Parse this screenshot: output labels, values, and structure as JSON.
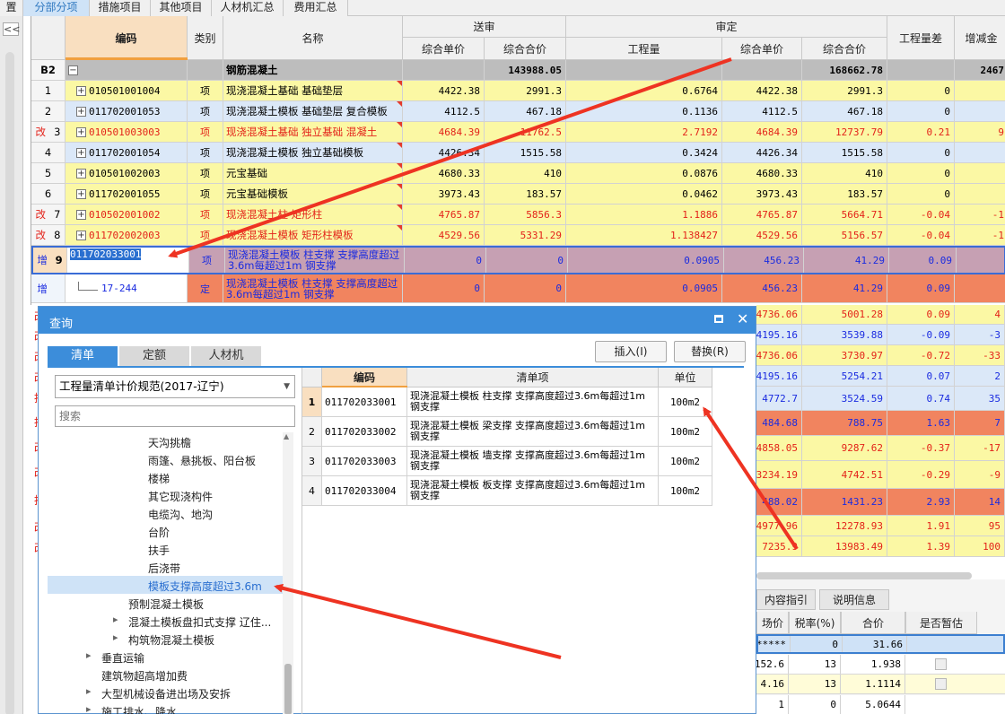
{
  "tabs": [
    "置",
    "分部分项",
    "措施项目",
    "其他项目",
    "人材机汇总",
    "费用汇总"
  ],
  "rail": {
    "collapse_label": "<<"
  },
  "grid": {
    "headers": {
      "code": "编码",
      "type": "类别",
      "name": "名称",
      "sent": "送审",
      "approved": "审定",
      "s_unit": "综合单价",
      "s_total": "综合合价",
      "qty": "工程量",
      "a_unit": "综合单价",
      "a_total": "综合合价",
      "qty_diff": "工程量差",
      "amount": "增减金"
    },
    "rows": [
      {
        "idx": "B2",
        "flag": "",
        "expander": "−",
        "code": "",
        "type": "",
        "name": "钢筋混凝土",
        "s_unit": "",
        "s_total": "143988.05",
        "qty": "",
        "a_unit": "",
        "a_total": "168662.78",
        "diff": "",
        "amt": "2467"
      },
      {
        "idx": "1",
        "flag": "",
        "expander": "+",
        "code": "010501001004",
        "type": "项",
        "name": "现浇混凝土基础 基础垫层",
        "s_unit": "4422.38",
        "s_total": "2991.3",
        "qty": "0.6764",
        "a_unit": "4422.38",
        "a_total": "2991.3",
        "diff": "0",
        "amt": ""
      },
      {
        "idx": "2",
        "flag": "",
        "expander": "+",
        "code": "011702001053",
        "type": "项",
        "name": "现浇混凝土模板 基础垫层 复合模板",
        "s_unit": "4112.5",
        "s_total": "467.18",
        "qty": "0.1136",
        "a_unit": "4112.5",
        "a_total": "467.18",
        "diff": "0",
        "amt": ""
      },
      {
        "idx": "3",
        "flag": "改",
        "expander": "+",
        "code": "010501003003",
        "type": "项",
        "name": "现浇混凝土基础 独立基础 混凝土",
        "s_unit": "4684.39",
        "s_total": "11762.5",
        "qty": "2.7192",
        "a_unit": "4684.39",
        "a_total": "12737.79",
        "diff": "0.21",
        "amt": "9"
      },
      {
        "idx": "4",
        "flag": "",
        "expander": "+",
        "code": "011702001054",
        "type": "项",
        "name": "现浇混凝土模板 独立基础模板",
        "s_unit": "4426.34",
        "s_total": "1515.58",
        "qty": "0.3424",
        "a_unit": "4426.34",
        "a_total": "1515.58",
        "diff": "0",
        "amt": ""
      },
      {
        "idx": "5",
        "flag": "",
        "expander": "+",
        "code": "010501002003",
        "type": "项",
        "name": "元宝基础",
        "s_unit": "4680.33",
        "s_total": "410",
        "qty": "0.0876",
        "a_unit": "4680.33",
        "a_total": "410",
        "diff": "0",
        "amt": ""
      },
      {
        "idx": "6",
        "flag": "",
        "expander": "+",
        "code": "011702001055",
        "type": "项",
        "name": "元宝基础模板",
        "s_unit": "3973.43",
        "s_total": "183.57",
        "qty": "0.0462",
        "a_unit": "3973.43",
        "a_total": "183.57",
        "diff": "0",
        "amt": ""
      },
      {
        "idx": "7",
        "flag": "改",
        "expander": "+",
        "code": "010502001002",
        "type": "项",
        "name": "现浇混凝土柱 矩形柱",
        "s_unit": "4765.87",
        "s_total": "5856.3",
        "qty": "1.1886",
        "a_unit": "4765.87",
        "a_total": "5664.71",
        "diff": "-0.04",
        "amt": "-1"
      },
      {
        "idx": "8",
        "flag": "改",
        "expander": "+",
        "code": "011702002003",
        "type": "项",
        "name": "现浇混凝土模板 矩形柱模板",
        "s_unit": "4529.56",
        "s_total": "5331.29",
        "qty": "1.138427",
        "a_unit": "4529.56",
        "a_total": "5156.57",
        "diff": "-0.04",
        "amt": "-1"
      },
      {
        "idx": "9",
        "flag": "增",
        "expander": "",
        "code": "011702033001",
        "type": "项",
        "name": "现浇混凝土模板 柱支撑 支撑高度超过3.6m每超过1m 钢支撑",
        "s_unit": "0",
        "s_total": "0",
        "qty": "0.0905",
        "a_unit": "456.23",
        "a_total": "41.29",
        "diff": "0.09",
        "amt": ""
      },
      {
        "idx": "",
        "flag": "增",
        "expander": "",
        "code": "17-244",
        "type": "定",
        "name": "现浇混凝土模板 柱支撑 支撑高度超过3.6m每超过1m 钢支撑",
        "s_unit": "0",
        "s_total": "0",
        "qty": "0.0905",
        "a_unit": "456.23",
        "a_total": "41.29",
        "diff": "0.09",
        "amt": ""
      }
    ]
  },
  "bg_rows": [
    {
      "a_unit": "4736.06",
      "a_total": "5001.28",
      "diff": "0.09",
      "amt": "4"
    },
    {
      "a_unit": "4195.16",
      "a_total": "3539.88",
      "diff": "-0.09",
      "amt": "-3"
    },
    {
      "a_unit": "4736.06",
      "a_total": "3730.97",
      "diff": "-0.72",
      "amt": "-33"
    },
    {
      "a_unit": "4195.16",
      "a_total": "5254.21",
      "diff": "0.07",
      "amt": "2"
    },
    {
      "a_unit": "4772.7",
      "a_total": "3524.59",
      "diff": "0.74",
      "amt": "35"
    },
    {
      "a_unit": "484.68",
      "a_total": "788.75",
      "diff": "1.63",
      "amt": "7"
    },
    {
      "a_unit": "4858.05",
      "a_total": "9287.62",
      "diff": "-0.37",
      "amt": "-17"
    },
    {
      "a_unit": "3234.19",
      "a_total": "4742.51",
      "diff": "-0.29",
      "amt": "-9"
    },
    {
      "a_unit": "488.02",
      "a_total": "1431.23",
      "diff": "2.93",
      "amt": "14"
    },
    {
      "a_unit": "4977.96",
      "a_total": "12278.93",
      "diff": "1.91",
      "amt": "95"
    },
    {
      "a_unit": "7235.9",
      "a_total": "13983.49",
      "diff": "1.39",
      "amt": "100"
    }
  ],
  "left_flags": [
    "改",
    "改",
    "改",
    "改",
    "拆",
    "拆",
    "改",
    "改",
    "拆",
    "改",
    "改"
  ],
  "dialog": {
    "title": "查询",
    "tabs": [
      "清单",
      "定额",
      "人材机"
    ],
    "insert_label": "插入(I)",
    "replace_label": "替换(R)",
    "norm_select": "工程量清单计价规范(2017-辽宁)",
    "search_placeholder": "搜索",
    "tree": [
      {
        "label": "天沟挑檐",
        "level": 3,
        "arrow": ""
      },
      {
        "label": "雨篷、悬挑板、阳台板",
        "level": 3,
        "arrow": ""
      },
      {
        "label": "楼梯",
        "level": 3,
        "arrow": ""
      },
      {
        "label": "其它现浇构件",
        "level": 3,
        "arrow": ""
      },
      {
        "label": "电缆沟、地沟",
        "level": 3,
        "arrow": ""
      },
      {
        "label": "台阶",
        "level": 3,
        "arrow": ""
      },
      {
        "label": "扶手",
        "level": 3,
        "arrow": ""
      },
      {
        "label": "后浇带",
        "level": 3,
        "arrow": ""
      },
      {
        "label": "模板支撑高度超过3.6m",
        "level": 3,
        "arrow": "",
        "selected": true
      },
      {
        "label": "预制混凝土模板",
        "level": 2,
        "arrow": ""
      },
      {
        "label": "混凝土模板盘扣式支撑 辽住...",
        "level": 2,
        "arrow": "▸"
      },
      {
        "label": "构筑物混凝土模板",
        "level": 2,
        "arrow": "▸"
      },
      {
        "label": "垂直运输",
        "level": 1,
        "arrow": "▸"
      },
      {
        "label": "建筑物超高增加费",
        "level": 1,
        "arrow": ""
      },
      {
        "label": "大型机械设备进出场及安拆",
        "level": 1,
        "arrow": "▸"
      },
      {
        "label": "施工排水、降水",
        "level": 1,
        "arrow": "▸"
      }
    ],
    "results": {
      "headers": {
        "code": "编码",
        "item": "清单项",
        "unit": "单位"
      },
      "rows": [
        {
          "idx": "1",
          "code": "011702033001",
          "item": "现浇混凝土模板 柱支撑 支撑高度超过3.6m每超过1m 钢支撑",
          "unit": "100m2"
        },
        {
          "idx": "2",
          "code": "011702033002",
          "item": "现浇混凝土模板 梁支撑 支撑高度超过3.6m每超过1m 钢支撑",
          "unit": "100m2"
        },
        {
          "idx": "3",
          "code": "011702033003",
          "item": "现浇混凝土模板 墙支撑 支撑高度超过3.6m每超过1m 钢支撑",
          "unit": "100m2"
        },
        {
          "idx": "4",
          "code": "011702033004",
          "item": "现浇混凝土模板 板支撑 支撑高度超过3.6m每超过1m 钢支撑",
          "unit": "100m2"
        }
      ]
    }
  },
  "lower_panel": {
    "tabs": [
      "内容指引",
      "说明信息"
    ],
    "headers": {
      "price": "场价",
      "tax": "税率(%)",
      "total": "合价",
      "tentative": "是否暂估"
    },
    "rows": [
      {
        "price": "*****",
        "tax": "0",
        "total": "31.66"
      },
      {
        "price": "1152.6",
        "tax": "13",
        "total": "1.938"
      },
      {
        "price": "4.16",
        "tax": "13",
        "total": "1.1114"
      },
      {
        "price": "1",
        "tax": "0",
        "total": "5.0644"
      }
    ]
  }
}
